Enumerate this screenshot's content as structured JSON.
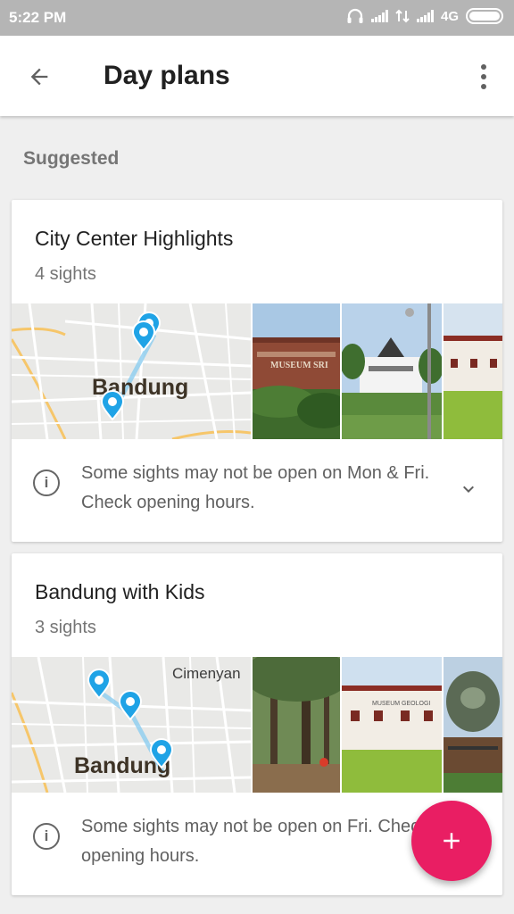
{
  "status": {
    "time": "5:22 PM",
    "network": "4G"
  },
  "appbar": {
    "title": "Day plans"
  },
  "section": {
    "label": "Suggested"
  },
  "plans": [
    {
      "title": "City Center Highlights",
      "sights": "4 sights",
      "map_label": "Bandung",
      "note": "Some sights may not be open on Mon & Fri. Check opening hours."
    },
    {
      "title": "Bandung with Kids",
      "sights": "3 sights",
      "map_label": "Bandung",
      "map_label_2": "Cimenyan",
      "note": "Some sights may not be open on Fri. Check opening hours."
    }
  ],
  "photo_signs": {
    "museum_wall": "MUSEUM SRI",
    "museum_geologi": "MUSEUM GEOLOGI"
  },
  "colors": {
    "accent": "#e91e63",
    "pin": "#1fa3e6"
  },
  "icons": [
    "back-arrow-icon",
    "more-vert-icon",
    "info-icon",
    "chevron-down-icon",
    "add-icon",
    "headset-icon",
    "signal-icon",
    "battery-icon"
  ]
}
